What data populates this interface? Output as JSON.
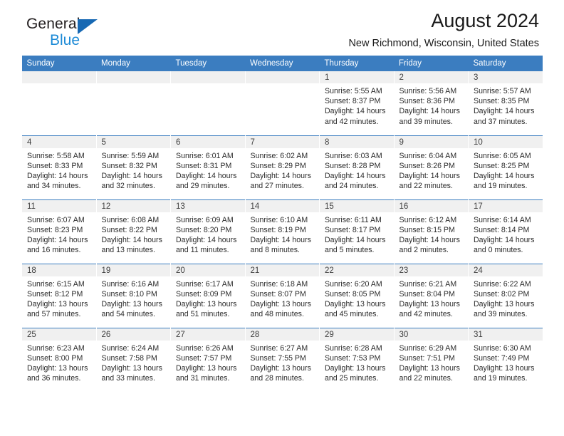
{
  "brand": {
    "name_top": "General",
    "name_bottom": "Blue",
    "triangle_color": "#1668b3",
    "blue_text_color": "#1c8ad6"
  },
  "header": {
    "title": "August 2024",
    "subtitle": "New Richmond, Wisconsin, United States"
  },
  "theme": {
    "header_blue": "#3b7dc0",
    "daynum_band": "#f0f0f0",
    "text": "#2b2b2b"
  },
  "labels": {
    "sunrise_prefix": "Sunrise:",
    "sunset_prefix": "Sunset:",
    "daylight_prefix": "Daylight:"
  },
  "weekdays": [
    "Sunday",
    "Monday",
    "Tuesday",
    "Wednesday",
    "Thursday",
    "Friday",
    "Saturday"
  ],
  "weeks": [
    [
      {
        "day": "",
        "empty": true
      },
      {
        "day": "",
        "empty": true
      },
      {
        "day": "",
        "empty": true
      },
      {
        "day": "",
        "empty": true
      },
      {
        "day": "1",
        "sunrise": "Sunrise: 5:55 AM",
        "sunset": "Sunset: 8:37 PM",
        "daylight_line1": "Daylight: 14 hours",
        "daylight_line2": "and 42 minutes."
      },
      {
        "day": "2",
        "sunrise": "Sunrise: 5:56 AM",
        "sunset": "Sunset: 8:36 PM",
        "daylight_line1": "Daylight: 14 hours",
        "daylight_line2": "and 39 minutes."
      },
      {
        "day": "3",
        "sunrise": "Sunrise: 5:57 AM",
        "sunset": "Sunset: 8:35 PM",
        "daylight_line1": "Daylight: 14 hours",
        "daylight_line2": "and 37 minutes."
      }
    ],
    [
      {
        "day": "4",
        "sunrise": "Sunrise: 5:58 AM",
        "sunset": "Sunset: 8:33 PM",
        "daylight_line1": "Daylight: 14 hours",
        "daylight_line2": "and 34 minutes."
      },
      {
        "day": "5",
        "sunrise": "Sunrise: 5:59 AM",
        "sunset": "Sunset: 8:32 PM",
        "daylight_line1": "Daylight: 14 hours",
        "daylight_line2": "and 32 minutes."
      },
      {
        "day": "6",
        "sunrise": "Sunrise: 6:01 AM",
        "sunset": "Sunset: 8:31 PM",
        "daylight_line1": "Daylight: 14 hours",
        "daylight_line2": "and 29 minutes."
      },
      {
        "day": "7",
        "sunrise": "Sunrise: 6:02 AM",
        "sunset": "Sunset: 8:29 PM",
        "daylight_line1": "Daylight: 14 hours",
        "daylight_line2": "and 27 minutes."
      },
      {
        "day": "8",
        "sunrise": "Sunrise: 6:03 AM",
        "sunset": "Sunset: 8:28 PM",
        "daylight_line1": "Daylight: 14 hours",
        "daylight_line2": "and 24 minutes."
      },
      {
        "day": "9",
        "sunrise": "Sunrise: 6:04 AM",
        "sunset": "Sunset: 8:26 PM",
        "daylight_line1": "Daylight: 14 hours",
        "daylight_line2": "and 22 minutes."
      },
      {
        "day": "10",
        "sunrise": "Sunrise: 6:05 AM",
        "sunset": "Sunset: 8:25 PM",
        "daylight_line1": "Daylight: 14 hours",
        "daylight_line2": "and 19 minutes."
      }
    ],
    [
      {
        "day": "11",
        "sunrise": "Sunrise: 6:07 AM",
        "sunset": "Sunset: 8:23 PM",
        "daylight_line1": "Daylight: 14 hours",
        "daylight_line2": "and 16 minutes."
      },
      {
        "day": "12",
        "sunrise": "Sunrise: 6:08 AM",
        "sunset": "Sunset: 8:22 PM",
        "daylight_line1": "Daylight: 14 hours",
        "daylight_line2": "and 13 minutes."
      },
      {
        "day": "13",
        "sunrise": "Sunrise: 6:09 AM",
        "sunset": "Sunset: 8:20 PM",
        "daylight_line1": "Daylight: 14 hours",
        "daylight_line2": "and 11 minutes."
      },
      {
        "day": "14",
        "sunrise": "Sunrise: 6:10 AM",
        "sunset": "Sunset: 8:19 PM",
        "daylight_line1": "Daylight: 14 hours",
        "daylight_line2": "and 8 minutes."
      },
      {
        "day": "15",
        "sunrise": "Sunrise: 6:11 AM",
        "sunset": "Sunset: 8:17 PM",
        "daylight_line1": "Daylight: 14 hours",
        "daylight_line2": "and 5 minutes."
      },
      {
        "day": "16",
        "sunrise": "Sunrise: 6:12 AM",
        "sunset": "Sunset: 8:15 PM",
        "daylight_line1": "Daylight: 14 hours",
        "daylight_line2": "and 2 minutes."
      },
      {
        "day": "17",
        "sunrise": "Sunrise: 6:14 AM",
        "sunset": "Sunset: 8:14 PM",
        "daylight_line1": "Daylight: 14 hours",
        "daylight_line2": "and 0 minutes."
      }
    ],
    [
      {
        "day": "18",
        "sunrise": "Sunrise: 6:15 AM",
        "sunset": "Sunset: 8:12 PM",
        "daylight_line1": "Daylight: 13 hours",
        "daylight_line2": "and 57 minutes."
      },
      {
        "day": "19",
        "sunrise": "Sunrise: 6:16 AM",
        "sunset": "Sunset: 8:10 PM",
        "daylight_line1": "Daylight: 13 hours",
        "daylight_line2": "and 54 minutes."
      },
      {
        "day": "20",
        "sunrise": "Sunrise: 6:17 AM",
        "sunset": "Sunset: 8:09 PM",
        "daylight_line1": "Daylight: 13 hours",
        "daylight_line2": "and 51 minutes."
      },
      {
        "day": "21",
        "sunrise": "Sunrise: 6:18 AM",
        "sunset": "Sunset: 8:07 PM",
        "daylight_line1": "Daylight: 13 hours",
        "daylight_line2": "and 48 minutes."
      },
      {
        "day": "22",
        "sunrise": "Sunrise: 6:20 AM",
        "sunset": "Sunset: 8:05 PM",
        "daylight_line1": "Daylight: 13 hours",
        "daylight_line2": "and 45 minutes."
      },
      {
        "day": "23",
        "sunrise": "Sunrise: 6:21 AM",
        "sunset": "Sunset: 8:04 PM",
        "daylight_line1": "Daylight: 13 hours",
        "daylight_line2": "and 42 minutes."
      },
      {
        "day": "24",
        "sunrise": "Sunrise: 6:22 AM",
        "sunset": "Sunset: 8:02 PM",
        "daylight_line1": "Daylight: 13 hours",
        "daylight_line2": "and 39 minutes."
      }
    ],
    [
      {
        "day": "25",
        "sunrise": "Sunrise: 6:23 AM",
        "sunset": "Sunset: 8:00 PM",
        "daylight_line1": "Daylight: 13 hours",
        "daylight_line2": "and 36 minutes."
      },
      {
        "day": "26",
        "sunrise": "Sunrise: 6:24 AM",
        "sunset": "Sunset: 7:58 PM",
        "daylight_line1": "Daylight: 13 hours",
        "daylight_line2": "and 33 minutes."
      },
      {
        "day": "27",
        "sunrise": "Sunrise: 6:26 AM",
        "sunset": "Sunset: 7:57 PM",
        "daylight_line1": "Daylight: 13 hours",
        "daylight_line2": "and 31 minutes."
      },
      {
        "day": "28",
        "sunrise": "Sunrise: 6:27 AM",
        "sunset": "Sunset: 7:55 PM",
        "daylight_line1": "Daylight: 13 hours",
        "daylight_line2": "and 28 minutes."
      },
      {
        "day": "29",
        "sunrise": "Sunrise: 6:28 AM",
        "sunset": "Sunset: 7:53 PM",
        "daylight_line1": "Daylight: 13 hours",
        "daylight_line2": "and 25 minutes."
      },
      {
        "day": "30",
        "sunrise": "Sunrise: 6:29 AM",
        "sunset": "Sunset: 7:51 PM",
        "daylight_line1": "Daylight: 13 hours",
        "daylight_line2": "and 22 minutes."
      },
      {
        "day": "31",
        "sunrise": "Sunrise: 6:30 AM",
        "sunset": "Sunset: 7:49 PM",
        "daylight_line1": "Daylight: 13 hours",
        "daylight_line2": "and 19 minutes."
      }
    ]
  ]
}
